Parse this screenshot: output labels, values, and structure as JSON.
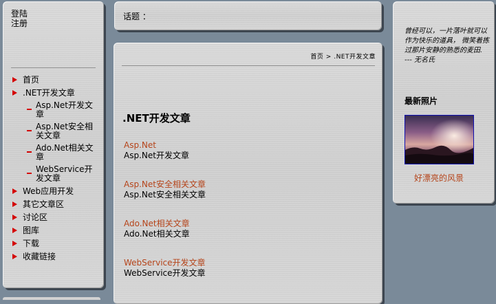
{
  "auth": {
    "login": "登陆",
    "register": "注册"
  },
  "nav": {
    "items": [
      {
        "label": "首页"
      },
      {
        "label": ".NET开发文章"
      },
      {
        "label": "Web应用开发"
      },
      {
        "label": "其它文章区"
      },
      {
        "label": "讨论区"
      },
      {
        "label": "图库"
      },
      {
        "label": "下载"
      },
      {
        "label": "收藏链接"
      }
    ],
    "subitems": [
      {
        "label": "Asp.Net开发文章"
      },
      {
        "label": "Asp.Net安全相关文章"
      },
      {
        "label": "Ado.Net相关文章"
      },
      {
        "label": "WebService开发文章"
      }
    ]
  },
  "topbar": {
    "topic_label": "话题 ："
  },
  "breadcrumb": {
    "home": "首页",
    "separator": ">",
    "current": ".NET开发文章"
  },
  "main": {
    "title": ".NET开发文章",
    "articles": [
      {
        "link": "Asp.Net",
        "desc": "Asp.Net开发文章"
      },
      {
        "link": "Asp.Net安全相关文章",
        "desc": "Asp.Net安全相关文章"
      },
      {
        "link": "Ado.Net相关文章",
        "desc": "Ado.Net相关文章"
      },
      {
        "link": "WebService开发文章",
        "desc": "WebService开发文章"
      }
    ]
  },
  "sidebar_right": {
    "quote": "曾经可以，一片落叶就可以作为快乐的道具， 微笑着拣过那片安静的熟悉的麦田.",
    "quote_author": "--- 无名氏",
    "photo_heading": "最新照片",
    "photo_caption": "好漂亮的风景"
  },
  "colors": {
    "background": "#7a8a99",
    "panel": "#d2d2d2",
    "link": "#b5441a",
    "bullet": "#d40000",
    "photo_border": "#1010b0"
  },
  "icons": {
    "nav_bullet": "red-triangle-icon",
    "sub_bullet": "red-dash-icon"
  }
}
